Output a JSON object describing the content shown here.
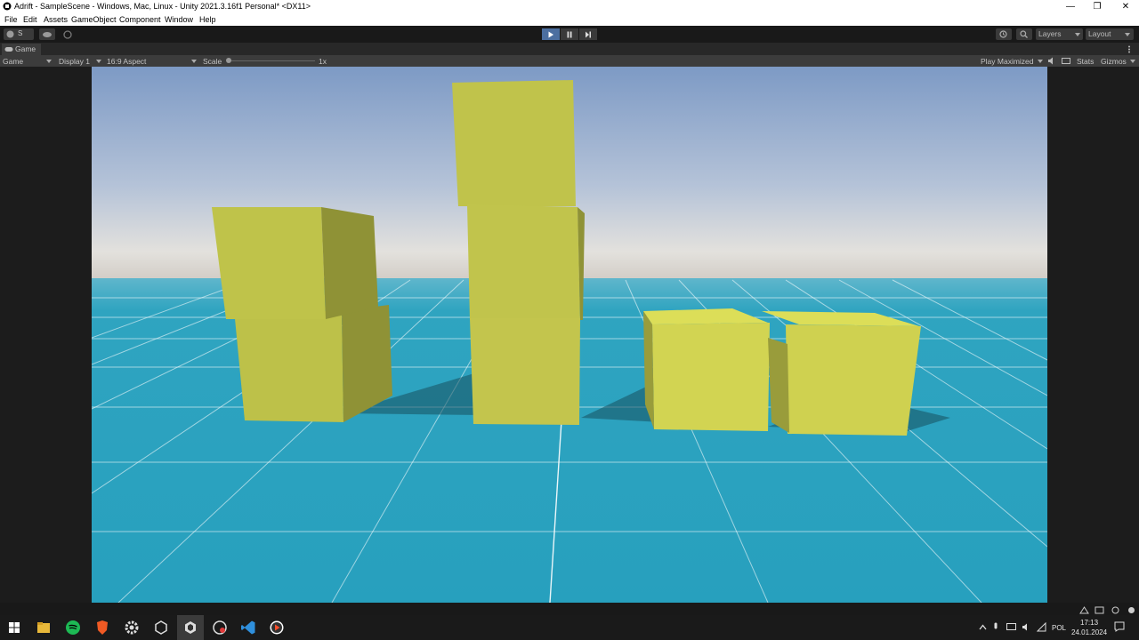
{
  "window": {
    "title": "Adrift - SampleScene - Windows, Mac, Linux - Unity 2021.3.16f1 Personal* <DX11>",
    "minimize": "—",
    "restore": "❐",
    "close": "✕"
  },
  "menu": [
    "File",
    "Edit",
    "Assets",
    "GameObject",
    "Component",
    "Window",
    "Help"
  ],
  "toolbar": {
    "account_label": "S",
    "layers_label": "Layers",
    "layout_label": "Layout",
    "play_icon": "play-icon",
    "pause_icon": "pause-icon",
    "step_icon": "step-icon"
  },
  "tab": {
    "label": "Game"
  },
  "gamebar": {
    "mode": "Game",
    "display": "Display 1",
    "aspect": "16:9 Aspect",
    "scale_label": "Scale",
    "scale_value": "1x",
    "play_mode": "Play Maximized",
    "stats": "Stats",
    "gizmos": "Gizmos"
  },
  "taskbar": {
    "language": "POL",
    "time": "17:13",
    "date": "24.01.2024"
  },
  "colors": {
    "cube": "#c4c64a",
    "floor": "#2aa2bf",
    "sky_top": "#7d9ac5",
    "play_active": "#4c6fa0"
  }
}
